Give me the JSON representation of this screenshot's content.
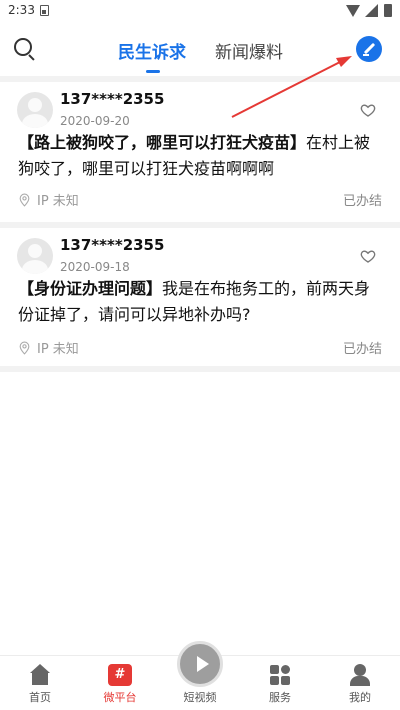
{
  "status_bar": {
    "time": "2:33"
  },
  "header": {
    "tabs": [
      {
        "label": "民生诉求",
        "active": true
      },
      {
        "label": "新闻爆料",
        "active": false
      }
    ],
    "accent_color": "#1a73e8",
    "icons": {
      "left": "search-icon",
      "right": "compose-icon"
    }
  },
  "posts": [
    {
      "author": "137****2355",
      "date": "2020-09-20",
      "title": "【路上被狗咬了，哪里可以打狂犬疫苗】",
      "body": "在村上被狗咬了，哪里可以打狂犬疫苗啊啊啊",
      "location": "IP 未知",
      "status": "已办结"
    },
    {
      "author": "137****2355",
      "date": "2020-09-18",
      "title": "【身份证办理问题】",
      "body": "我是在布拖务工的，前两天身份证掉了，请问可以异地补办吗?",
      "location": "IP 未知",
      "status": "已办结"
    }
  ],
  "bottom_nav": [
    {
      "label": "首页",
      "icon": "home-icon",
      "active": false
    },
    {
      "label": "微平台",
      "icon": "weibo-icon",
      "glyph": "#",
      "active": true
    },
    {
      "label": "短视频",
      "icon": "play-icon",
      "active": false
    },
    {
      "label": "服务",
      "icon": "grid-icon",
      "active": false
    },
    {
      "label": "我的",
      "icon": "user-icon",
      "active": false
    }
  ],
  "colors": {
    "active_nav": "#e53935",
    "annotation_arrow": "#e53935"
  }
}
